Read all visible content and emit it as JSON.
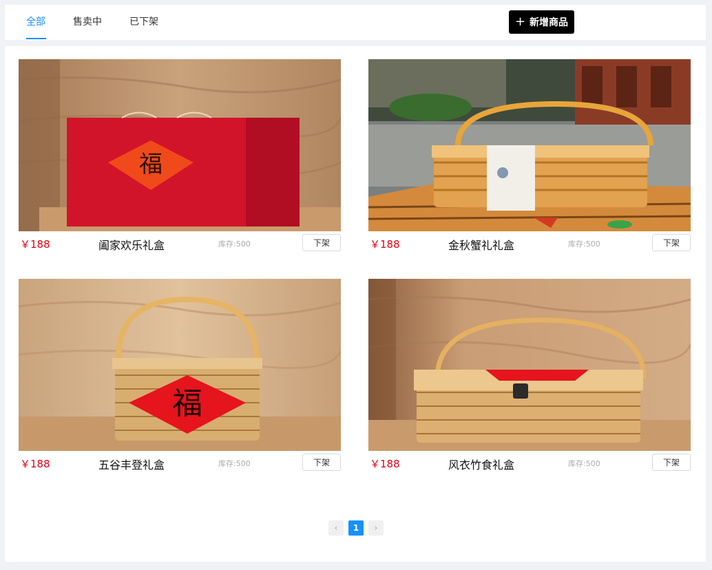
{
  "tabs": [
    {
      "label": "全部",
      "active": true
    },
    {
      "label": "售卖中",
      "active": false
    },
    {
      "label": "已下架",
      "active": false
    }
  ],
  "add_button": {
    "icon": "plus-icon",
    "label": "新增商品"
  },
  "products": [
    {
      "price": "￥188",
      "name": "阖家欢乐礼盒",
      "stock": "库存:500",
      "action": "下架",
      "image": "red-gift-bag-photo"
    },
    {
      "price": "￥188",
      "name": "金秋蟹礼礼盒",
      "stock": "库存:500",
      "action": "下架",
      "image": "bamboo-crab-basket-photo"
    },
    {
      "price": "￥188",
      "name": "五谷丰登礼盒",
      "stock": "库存:500",
      "action": "下架",
      "image": "bamboo-fu-basket-photo"
    },
    {
      "price": "￥188",
      "name": "风衣竹食礼盒",
      "stock": "库存:500",
      "action": "下架",
      "image": "bamboo-hamper-photo"
    }
  ],
  "pagination": {
    "prev": "‹",
    "current": "1",
    "next": "›"
  },
  "colors": {
    "accent": "#1890ff",
    "price": "#e60012",
    "button_dark": "#000000"
  }
}
